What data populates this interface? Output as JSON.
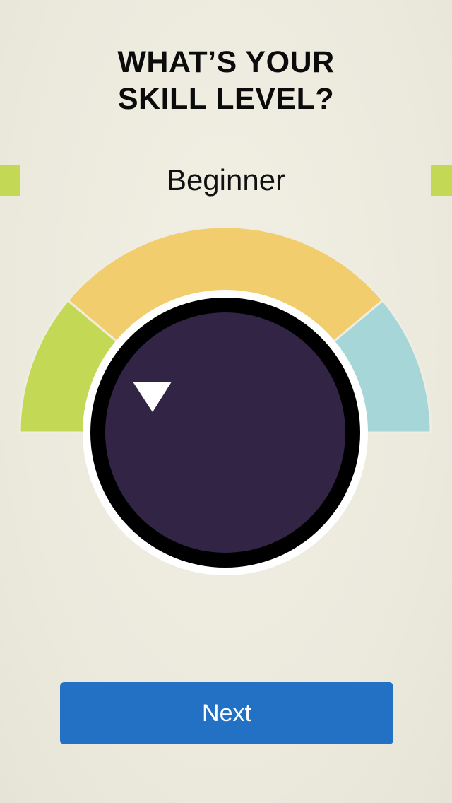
{
  "screen": {
    "title_line1": "WHAT’S YOUR",
    "title_line2": "SKILL LEVEL?"
  },
  "skill_selector": {
    "selected_label": "Beginner",
    "segments": [
      {
        "name": "segment-beginner",
        "color": "#c3d955"
      },
      {
        "name": "segment-intermediate",
        "color": "#f2cd6d"
      },
      {
        "name": "segment-advanced",
        "color": "#a6d6d8"
      }
    ],
    "knob_color": "#312445",
    "knob_ring_color": "#000000",
    "pointer_icon": "triangle-pointer-icon",
    "edge_marker_color": "#c3d955"
  },
  "actions": {
    "next_label": "Next",
    "next_color": "#2271c4"
  }
}
